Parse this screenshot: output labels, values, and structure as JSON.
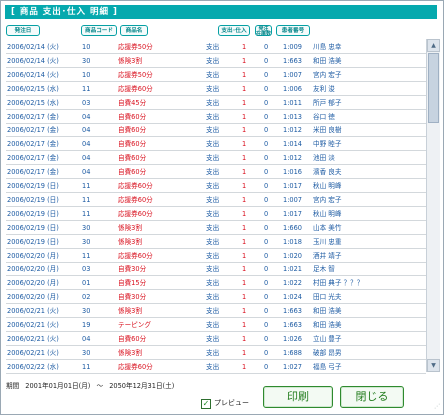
{
  "window": {
    "title": "[ 商品 支出･仕入 明細 ]"
  },
  "headers": {
    "date": "発注日",
    "code": "商品コード",
    "name": "商品名",
    "kind": "支出･仕入",
    "unit_line1": "発注",
    "unit_line2": "在庫数",
    "customer": "患者番号"
  },
  "rows": [
    {
      "date": "2006/02/14 (火)",
      "qty": "10",
      "name": "応援券50分",
      "kind": "支出",
      "one": "1",
      "zero": "0",
      "id": "1:009",
      "who": "川島 忠幸"
    },
    {
      "date": "2006/02/14 (火)",
      "qty": "30",
      "name": "係険3割",
      "kind": "支出",
      "one": "1",
      "zero": "0",
      "id": "1:663",
      "who": "和田 浩美"
    },
    {
      "date": "2006/02/14 (火)",
      "qty": "10",
      "name": "応援券50分",
      "kind": "支出",
      "one": "1",
      "zero": "0",
      "id": "1:007",
      "who": "宮内 宏子"
    },
    {
      "date": "2006/02/15 (水)",
      "qty": "11",
      "name": "応援券60分",
      "kind": "支出",
      "one": "1",
      "zero": "0",
      "id": "1:006",
      "who": "友利 浚"
    },
    {
      "date": "2006/02/15 (水)",
      "qty": "03",
      "name": "自費45分",
      "kind": "支出",
      "one": "1",
      "zero": "0",
      "id": "1:011",
      "who": "所戸 郁子"
    },
    {
      "date": "2006/02/17 (金)",
      "qty": "04",
      "name": "自費60分",
      "kind": "支出",
      "one": "1",
      "zero": "0",
      "id": "1:013",
      "who": "谷口 徳"
    },
    {
      "date": "2006/02/17 (金)",
      "qty": "04",
      "name": "自費60分",
      "kind": "支出",
      "one": "1",
      "zero": "0",
      "id": "1:012",
      "who": "米田 良樹"
    },
    {
      "date": "2006/02/17 (金)",
      "qty": "04",
      "name": "自費60分",
      "kind": "支出",
      "one": "1",
      "zero": "0",
      "id": "1:014",
      "who": "中野 睦子"
    },
    {
      "date": "2006/02/17 (金)",
      "qty": "04",
      "name": "自費60分",
      "kind": "支出",
      "one": "1",
      "zero": "0",
      "id": "1:012",
      "who": "池田 淡"
    },
    {
      "date": "2006/02/17 (金)",
      "qty": "04",
      "name": "自費60分",
      "kind": "支出",
      "one": "1",
      "zero": "0",
      "id": "1:016",
      "who": "濱香 良夫"
    },
    {
      "date": "2006/02/19 (日)",
      "qty": "11",
      "name": "応援券60分",
      "kind": "支出",
      "one": "1",
      "zero": "0",
      "id": "1:017",
      "who": "秋山 明峰"
    },
    {
      "date": "2006/02/19 (日)",
      "qty": "11",
      "name": "応援券60分",
      "kind": "支出",
      "one": "1",
      "zero": "0",
      "id": "1:007",
      "who": "宮内 宏子"
    },
    {
      "date": "2006/02/19 (日)",
      "qty": "11",
      "name": "応援券60分",
      "kind": "支出",
      "one": "1",
      "zero": "0",
      "id": "1:017",
      "who": "秋山 明峰"
    },
    {
      "date": "2006/02/19 (日)",
      "qty": "30",
      "name": "係険3割",
      "kind": "支出",
      "one": "1",
      "zero": "0",
      "id": "1:660",
      "who": "山本 美竹"
    },
    {
      "date": "2006/02/19 (日)",
      "qty": "30",
      "name": "係険3割",
      "kind": "支出",
      "one": "1",
      "zero": "0",
      "id": "1:018",
      "who": "玉川 忠重"
    },
    {
      "date": "2006/02/20 (月)",
      "qty": "11",
      "name": "応援券60分",
      "kind": "支出",
      "one": "1",
      "zero": "0",
      "id": "1:020",
      "who": "酒井 靖子"
    },
    {
      "date": "2006/02/20 (月)",
      "qty": "03",
      "name": "自費30分",
      "kind": "支出",
      "one": "1",
      "zero": "0",
      "id": "1:021",
      "who": "足木 智"
    },
    {
      "date": "2006/02/20 (月)",
      "qty": "01",
      "name": "自費15分",
      "kind": "支出",
      "one": "1",
      "zero": "0",
      "id": "1:022",
      "who": "村田 典子 ？？？"
    },
    {
      "date": "2006/02/20 (月)",
      "qty": "02",
      "name": "自費30分",
      "kind": "支出",
      "one": "1",
      "zero": "0",
      "id": "1:024",
      "who": "田口 光夫"
    },
    {
      "date": "2006/02/21 (火)",
      "qty": "30",
      "name": "係険3割",
      "kind": "支出",
      "one": "1",
      "zero": "0",
      "id": "1:663",
      "who": "和田 浩美"
    },
    {
      "date": "2006/02/21 (火)",
      "qty": "19",
      "name": "テーピング",
      "kind": "支出",
      "one": "1",
      "zero": "0",
      "id": "1:663",
      "who": "和田 浩美"
    },
    {
      "date": "2006/02/21 (火)",
      "qty": "04",
      "name": "自費60分",
      "kind": "支出",
      "one": "1",
      "zero": "0",
      "id": "1:026",
      "who": "立山 豊子"
    },
    {
      "date": "2006/02/21 (火)",
      "qty": "30",
      "name": "係険3割",
      "kind": "支出",
      "one": "1",
      "zero": "0",
      "id": "1:688",
      "who": "破部 昂男"
    },
    {
      "date": "2006/02/22 (水)",
      "qty": "11",
      "name": "応援券60分",
      "kind": "支出",
      "one": "1",
      "zero": "0",
      "id": "1:027",
      "who": "福島 弓子"
    }
  ],
  "footer": {
    "period_label": "期間",
    "period_start": "2001年01月01日(月)",
    "period_sep": "～",
    "period_end": "2050年12月31日(土)",
    "preview_label": "プレビュー",
    "print_label": "印刷",
    "close_label": "閉じる"
  },
  "icons": {
    "scroll_up": "▲",
    "scroll_down": "▼",
    "check": "✓",
    "resize": "⋰"
  }
}
